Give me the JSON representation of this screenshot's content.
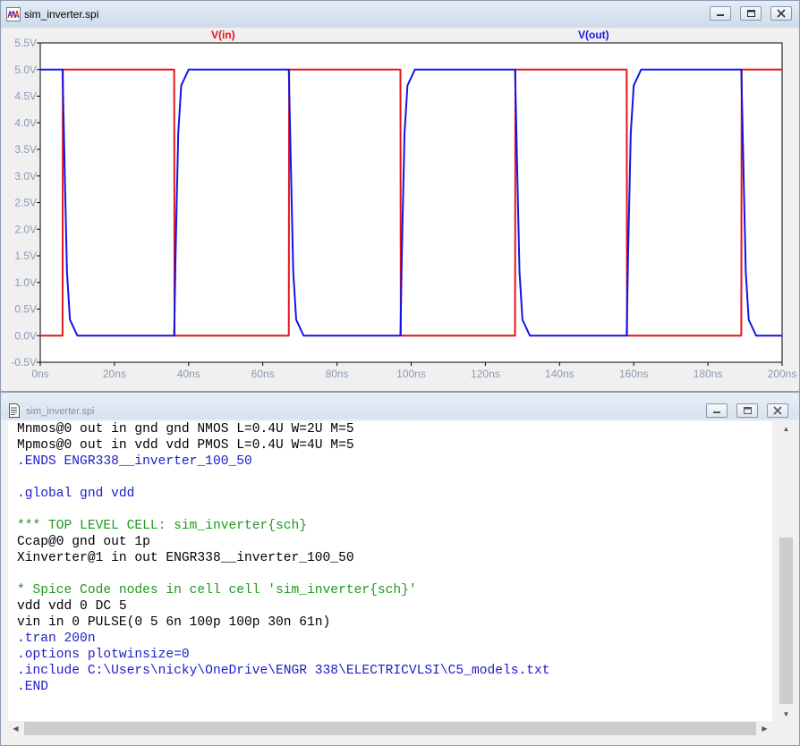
{
  "plot_window": {
    "title": "sim_inverter.spi",
    "legend_vin": "V(in)",
    "legend_vout": "V(out)",
    "colors": {
      "vin": "#e0151b",
      "vout": "#1414e6",
      "plot_bg": "#ffffff",
      "axis_text": "#8a9ab3"
    }
  },
  "chart_data": {
    "type": "line",
    "xlabel": "",
    "ylabel": "",
    "x_ticks": [
      "0ns",
      "20ns",
      "40ns",
      "60ns",
      "80ns",
      "100ns",
      "120ns",
      "140ns",
      "160ns",
      "180ns",
      "200ns"
    ],
    "y_ticks": [
      "-0.5V",
      "0.0V",
      "0.5V",
      "1.0V",
      "1.5V",
      "2.0V",
      "2.5V",
      "3.0V",
      "3.5V",
      "4.0V",
      "4.5V",
      "5.0V",
      "5.5V"
    ],
    "xlim": [
      0,
      200
    ],
    "ylim": [
      -0.5,
      5.5
    ],
    "grid": false,
    "series": [
      {
        "name": "V(in)",
        "x": [
          0,
          6,
          6.1,
          36.1,
          36.2,
          67,
          67.1,
          97.1,
          97.2,
          128,
          128.1,
          158.1,
          158.2,
          189,
          189.1,
          200
        ],
        "y": [
          0,
          0,
          5,
          5,
          0,
          0,
          5,
          5,
          0,
          0,
          5,
          5,
          0,
          0,
          5,
          5
        ]
      },
      {
        "name": "V(out)",
        "x": [
          0,
          6,
          6.5,
          7.2,
          8,
          10,
          36.1,
          36.5,
          37.2,
          38,
          40,
          67,
          67.5,
          68.2,
          69,
          71,
          97.1,
          97.5,
          98.2,
          99,
          101,
          128,
          128.5,
          129.2,
          130,
          132,
          158.1,
          158.5,
          159.2,
          160,
          162,
          189,
          189.5,
          190.2,
          191,
          193,
          200
        ],
        "y": [
          5,
          5,
          3.4,
          1.2,
          0.3,
          0,
          0,
          1.6,
          3.8,
          4.7,
          5,
          5,
          3.4,
          1.2,
          0.3,
          0,
          0,
          1.6,
          3.8,
          4.7,
          5,
          5,
          3.4,
          1.2,
          0.3,
          0,
          0,
          1.6,
          3.8,
          4.7,
          5,
          5,
          3.4,
          1.2,
          0.3,
          0,
          0
        ]
      }
    ]
  },
  "netlist_window": {
    "title": "sim_inverter.spi",
    "colors": {
      "text": "#000000",
      "directive": "#1c1cc8",
      "comment": "#1e9a1e"
    },
    "lines": [
      {
        "text": "Mnmos@0 out in gnd gnd NMOS L=0.4U W=2U M=5",
        "kind": "text"
      },
      {
        "text": "Mpmos@0 out in vdd vdd PMOS L=0.4U W=4U M=5",
        "kind": "text"
      },
      {
        "text": ".ENDS ENGR338__inverter_100_50",
        "kind": "directive"
      },
      {
        "text": "",
        "kind": "text"
      },
      {
        "text": ".global gnd vdd",
        "kind": "directive"
      },
      {
        "text": "",
        "kind": "text"
      },
      {
        "text": "*** TOP LEVEL CELL: sim_inverter{sch}",
        "kind": "comment"
      },
      {
        "text": "Ccap@0 gnd out 1p",
        "kind": "text"
      },
      {
        "text": "Xinverter@1 in out ENGR338__inverter_100_50",
        "kind": "text"
      },
      {
        "text": "",
        "kind": "text"
      },
      {
        "text": "* Spice Code nodes in cell cell 'sim_inverter{sch}'",
        "kind": "comment"
      },
      {
        "text": "vdd vdd 0 DC 5",
        "kind": "text"
      },
      {
        "text": "vin in 0 PULSE(0 5 6n 100p 100p 30n 61n)",
        "kind": "text"
      },
      {
        "text": ".tran 200n",
        "kind": "directive"
      },
      {
        "text": ".options plotwinsize=0",
        "kind": "directive"
      },
      {
        "text": ".include C:\\Users\\nicky\\OneDrive\\ENGR 338\\ELECTRICVLSI\\C5_models.txt",
        "kind": "directive"
      },
      {
        "text": ".END",
        "kind": "directive"
      }
    ]
  }
}
